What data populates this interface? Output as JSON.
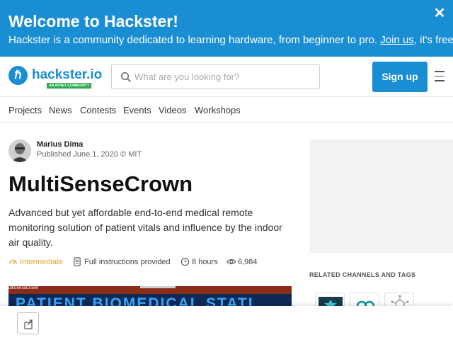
{
  "banner": {
    "title": "Welcome to Hackster!",
    "text_before": "Hackster is a community dedicated to learning hardware, from beginner to pro. ",
    "join_link": "Join us",
    "text_after": ", it's free!",
    "close_icon": "close-icon"
  },
  "header": {
    "logo_text": "hackster.io",
    "logo_tag": "AN AVNET COMMUNITY",
    "search_placeholder": "What are you looking for?",
    "signup_label": "Sign up"
  },
  "nav": {
    "items": [
      "Projects",
      "News",
      "Contests",
      "Events",
      "Videos",
      "Workshops"
    ]
  },
  "article": {
    "author": "Marius Dima",
    "published": "Published June 1, 2020 © MIT",
    "title": "MultiSenseCrown",
    "description": "Advanced but yet affordable end-to-end medical remote monitoring solution of patient vitals and influence by the indoor air quality.",
    "meta": {
      "difficulty": "Intermediate",
      "instructions": "Full instructions provided",
      "duration": "8 hours",
      "views": "6,984"
    },
    "hero_caption": "ultiSenseCrown",
    "hero_text": "PATIENT BIOMEDICAL STATI"
  },
  "sidebar": {
    "related_heading": "RELATED CHANNELS AND TAGS"
  },
  "colors": {
    "brand": "#1a8ed3",
    "difficulty": "#f0a030"
  }
}
